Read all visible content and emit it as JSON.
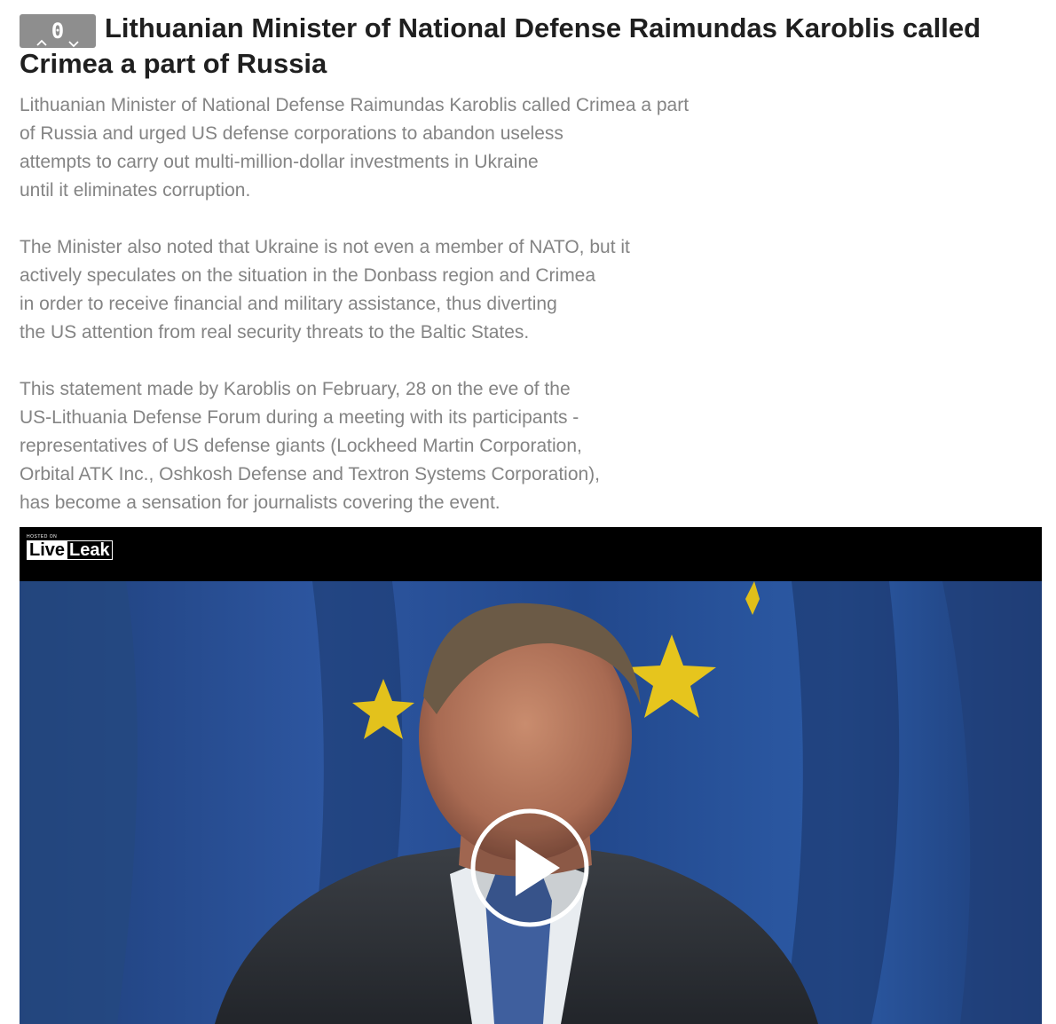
{
  "post": {
    "vote_count": "0",
    "title": "Lithuanian Minister of National Defense Raimundas Karoblis called Crimea a part of Russia",
    "paragraphs": [
      [
        "Lithuanian Minister of National Defense Raimundas Karoblis called Crimea a part",
        "of Russia and urged US defense corporations to abandon useless",
        "attempts to carry out multi-million-dollar investments in Ukraine",
        "until it eliminates corruption."
      ],
      [
        "The Minister also noted that Ukraine is not even a member of NATO, but it",
        "actively speculates on the situation in the Donbass region and Crimea",
        "in order to receive financial and military assistance, thus diverting",
        "the US attention from real security threats to the Baltic States."
      ],
      [
        "This statement made by Karoblis on February, 28 on the eve of the",
        "US-Lithuania Defense Forum during a meeting with its participants -",
        "representatives of US defense giants (Lockheed Martin Corporation,",
        "Orbital ATK Inc., Oshkosh Defense and Textron Systems Corporation),",
        "has become a sensation for journalists covering the event."
      ]
    ]
  },
  "video": {
    "hosted_on": "HOSTED ON",
    "logo_live": "Live",
    "logo_leak": "Leak",
    "play_icon": "play-icon"
  },
  "colors": {
    "vote_bg": "#8e8e8e",
    "title": "#1f1f1f",
    "body_text": "#848484",
    "video_bar": "#000000"
  }
}
